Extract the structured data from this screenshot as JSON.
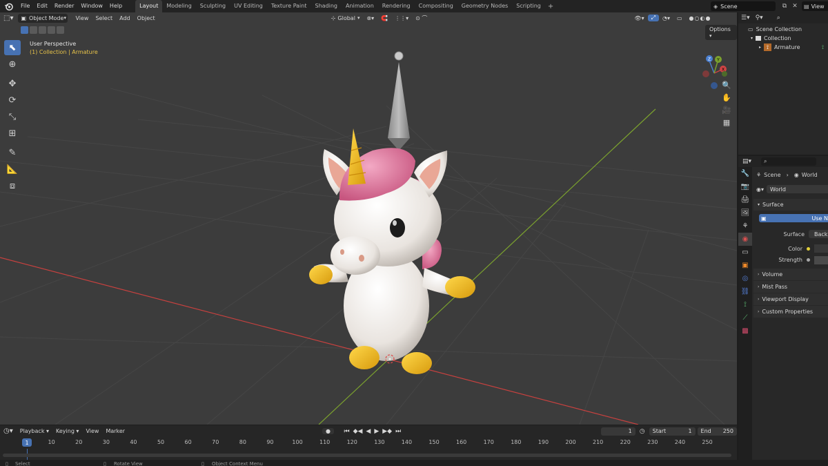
{
  "menu": [
    "File",
    "Edit",
    "Render",
    "Window",
    "Help"
  ],
  "workspaces": [
    "Layout",
    "Modeling",
    "Sculpting",
    "UV Editing",
    "Texture Paint",
    "Shading",
    "Animation",
    "Rendering",
    "Compositing",
    "Geometry Nodes",
    "Scripting"
  ],
  "active_workspace": "Layout",
  "scene_name": "Scene",
  "view_layer_label": "View",
  "viewport": {
    "mode": "Object Mode",
    "menus": [
      "View",
      "Select",
      "Add",
      "Object"
    ],
    "orientation": "Global",
    "options_label": "Options",
    "perspective_text": "User Perspective",
    "collection_text": "(1) Collection | Armature"
  },
  "tools": [
    "select-box-icon",
    "cursor-icon",
    "move-icon",
    "rotate-icon",
    "scale-icon",
    "transform-icon",
    "annotate-icon",
    "measure-icon",
    "add-cube-icon"
  ],
  "outliner": {
    "root": "Scene Collection",
    "collection": "Collection",
    "object": "Armature"
  },
  "properties": {
    "breadcrumb_scene": "Scene",
    "breadcrumb_world": "World",
    "world_name": "World",
    "surface_panel": "Surface",
    "use_nodes_label": "Use N",
    "surface_label": "Surface",
    "surface_value": "Back",
    "color_label": "Color",
    "strength_label": "Strength",
    "collapsed_panels": [
      "Volume",
      "Mist Pass",
      "Viewport Display",
      "Custom Properties"
    ]
  },
  "timeline": {
    "menus": [
      "Playback",
      "Keying",
      "View",
      "Marker"
    ],
    "current_frame": "1",
    "start_label": "Start",
    "start_value": "1",
    "end_label": "End",
    "end_value": "250",
    "ticks": [
      "10",
      "20",
      "30",
      "40",
      "50",
      "60",
      "70",
      "80",
      "90",
      "100",
      "110",
      "120",
      "130",
      "140",
      "150",
      "160",
      "170",
      "180",
      "190",
      "200",
      "210",
      "220",
      "230",
      "240",
      "250"
    ]
  },
  "statusbar": {
    "select": "Select",
    "rotate": "Rotate View",
    "context": "Object Context Menu"
  },
  "colors": {
    "accent": "#4772b3",
    "x_axis": "#c8413f",
    "y_axis": "#7ba12e",
    "collection_text": "#e8c34a"
  }
}
